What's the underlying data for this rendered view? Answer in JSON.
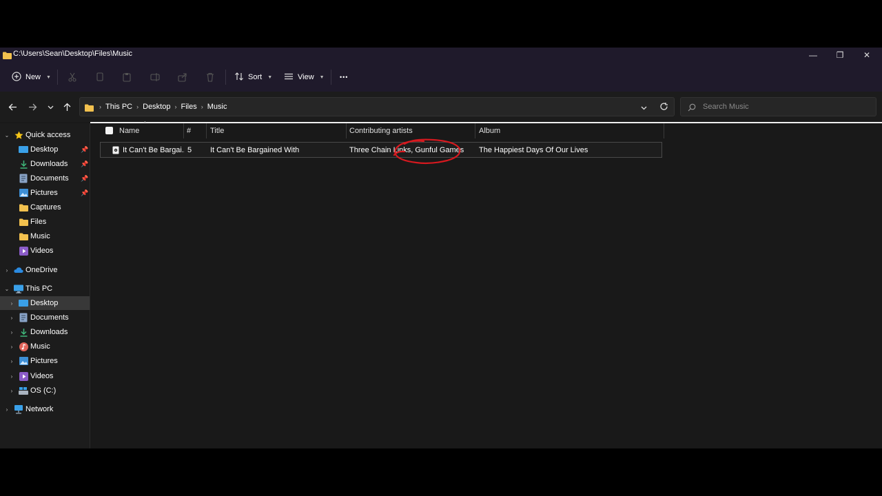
{
  "window": {
    "title": "C:\\Users\\Sean\\Desktop\\Files\\Music",
    "minimize_label": "—",
    "maximize_label": "❐",
    "close_label": "✕"
  },
  "commandbar": {
    "new_label": "New",
    "sort_label": "Sort",
    "view_label": "View",
    "more_label": "•••"
  },
  "navigation": {
    "breadcrumbs": [
      "This PC",
      "Desktop",
      "Files",
      "Music"
    ],
    "search_placeholder": "Search Music"
  },
  "sidebar": {
    "quick_access": "Quick access",
    "quick_items": [
      {
        "label": "Desktop",
        "icon": "desktop-icon",
        "pinned": true
      },
      {
        "label": "Downloads",
        "icon": "downloads-icon",
        "pinned": true
      },
      {
        "label": "Documents",
        "icon": "documents-icon",
        "pinned": true
      },
      {
        "label": "Pictures",
        "icon": "pictures-icon",
        "pinned": true
      },
      {
        "label": "Captures",
        "icon": "folder-icon",
        "pinned": false
      },
      {
        "label": "Files",
        "icon": "folder-icon",
        "pinned": false
      },
      {
        "label": "Music",
        "icon": "folder-icon",
        "pinned": false
      },
      {
        "label": "Videos",
        "icon": "videos-icon",
        "pinned": false
      }
    ],
    "onedrive": "OneDrive",
    "this_pc": "This PC",
    "pc_items": [
      {
        "label": "Desktop",
        "icon": "desktop-icon"
      },
      {
        "label": "Documents",
        "icon": "documents-icon"
      },
      {
        "label": "Downloads",
        "icon": "downloads-icon"
      },
      {
        "label": "Music",
        "icon": "music-icon"
      },
      {
        "label": "Pictures",
        "icon": "pictures-icon"
      },
      {
        "label": "Videos",
        "icon": "videos-icon"
      },
      {
        "label": "OS (C:)",
        "icon": "drive-icon"
      }
    ],
    "network": "Network",
    "selected": "This PC > Desktop"
  },
  "filelist": {
    "columns": [
      "Name",
      "#",
      "Title",
      "Contributing artists",
      "Album"
    ],
    "rows": [
      {
        "name": "It Can't Be Bargai...",
        "number": "5",
        "title": "It Can't Be Bargained With",
        "artists": "Three Chain Links, Gunful Games",
        "album": "The Happiest Days Of Our Lives"
      }
    ]
  },
  "colors": {
    "titlebar": "#1f1a2b",
    "background": "#191919",
    "annotation": "#d7191f",
    "folder": "#f2c14e"
  }
}
